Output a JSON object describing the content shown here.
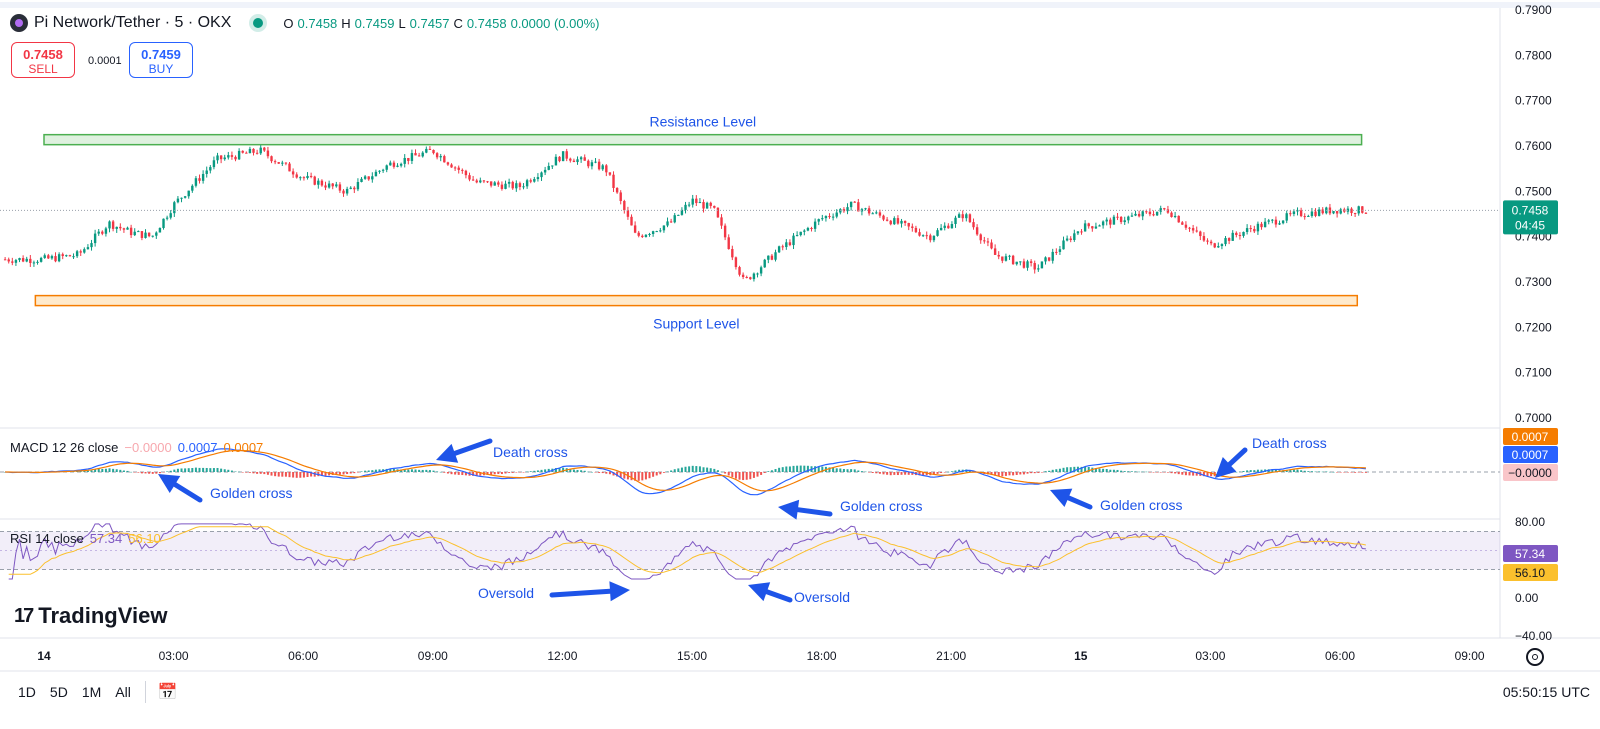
{
  "header": {
    "symbol": "Pi Network/Tether · 5 · OKX",
    "o_label": "O",
    "o": "0.7458",
    "h_label": "H",
    "h": "0.7459",
    "l_label": "L",
    "l": "0.7457",
    "c_label": "C",
    "c": "0.7458",
    "change": "0.0000 (0.00%)"
  },
  "trade": {
    "sell_price": "0.7458",
    "sell_label": "SELL",
    "spread": "0.0001",
    "buy_price": "0.7459",
    "buy_label": "BUY"
  },
  "macd_legend": {
    "name": "MACD 12 26 close",
    "hist": "−0.0000",
    "macd": "0.0007",
    "signal": "0.0007"
  },
  "rsi_legend": {
    "name": "RSI 14 close",
    "rsi": "57.34",
    "ma": "56.10"
  },
  "brand": "TradingView",
  "range_buttons": [
    "1D",
    "5D",
    "1M",
    "All"
  ],
  "clock": "05:50:15 UTC",
  "colors": {
    "up": "#089981",
    "down": "#f23645",
    "macd": "#2962ff",
    "signal": "#f57c00",
    "rsi": "#7e57c2",
    "rsi_ma": "#fbc02d",
    "annotation": "#1e54e8"
  },
  "chart_data": [
    {
      "type": "candlestick",
      "ylim": [
        0.7,
        0.79
      ],
      "yticks": [
        "0.7000",
        "0.7100",
        "0.7200",
        "0.7300",
        "0.7400",
        "0.7500",
        "0.7600",
        "0.7700",
        "0.7800",
        "0.7900"
      ],
      "xticks": [
        "14",
        "03:00",
        "06:00",
        "09:00",
        "12:00",
        "15:00",
        "18:00",
        "21:00",
        "15",
        "03:00",
        "06:00",
        "09:00"
      ],
      "x_hours": [
        0,
        3,
        6,
        9,
        12,
        15,
        18,
        21,
        24,
        27,
        30,
        33
      ],
      "price_path": [
        [
          0.0,
          0.735
        ],
        [
          0.8,
          0.736
        ],
        [
          1.5,
          0.743
        ],
        [
          2.0,
          0.741
        ],
        [
          2.5,
          0.74
        ],
        [
          3.0,
          0.747
        ],
        [
          4.0,
          0.757
        ],
        [
          5.0,
          0.759
        ],
        [
          6.0,
          0.753
        ],
        [
          7.0,
          0.75
        ],
        [
          8.0,
          0.756
        ],
        [
          9.0,
          0.759
        ],
        [
          10.0,
          0.752
        ],
        [
          11.0,
          0.751
        ],
        [
          12.0,
          0.758
        ],
        [
          13.0,
          0.755
        ],
        [
          13.7,
          0.74
        ],
        [
          14.5,
          0.743
        ],
        [
          15.0,
          0.748
        ],
        [
          15.5,
          0.746
        ],
        [
          16.2,
          0.73
        ],
        [
          17.0,
          0.737
        ],
        [
          18.0,
          0.744
        ],
        [
          18.7,
          0.747
        ],
        [
          19.5,
          0.744
        ],
        [
          20.5,
          0.74
        ],
        [
          21.3,
          0.745
        ],
        [
          22.0,
          0.736
        ],
        [
          23.0,
          0.733
        ],
        [
          24.0,
          0.742
        ],
        [
          25.0,
          0.744
        ],
        [
          26.0,
          0.746
        ],
        [
          27.0,
          0.738
        ],
        [
          28.0,
          0.742
        ],
        [
          29.0,
          0.745
        ],
        [
          30.0,
          0.746
        ],
        [
          30.6,
          0.7458
        ]
      ],
      "last_price": "0.7458",
      "countdown": "04:45",
      "zones": [
        {
          "label": "Resistance Level",
          "y_low": 0.761,
          "y_high": 0.7625,
          "x_start": 0.0,
          "x_end": 30.5,
          "color": "green"
        },
        {
          "label": "Support Level",
          "y_low": 0.7255,
          "y_high": 0.727,
          "x_start": -0.2,
          "x_end": 30.4,
          "color": "orange"
        }
      ]
    },
    {
      "type": "macd",
      "price_labels": [
        "0.0007",
        "0.0007",
        "−0.0000"
      ],
      "annotations": [
        {
          "text": "Death cross",
          "x_hour": 9.0
        },
        {
          "text": "Golden cross",
          "x_hour": 2.7
        },
        {
          "text": "Golden cross",
          "x_hour": 16.3
        },
        {
          "text": "Golden cross",
          "x_hour": 23.3
        },
        {
          "text": "Death cross",
          "x_hour": 28.0
        }
      ]
    },
    {
      "type": "rsi",
      "ylim": [
        -40,
        80
      ],
      "yticks": [
        "80.00",
        "0.00",
        "−40.00"
      ],
      "bands": [
        30,
        70
      ],
      "value_labels": [
        "57.34",
        "56.10"
      ],
      "annotations": [
        {
          "text": "Oversold",
          "x_hour": 13.8
        },
        {
          "text": "Oversold",
          "x_hour": 16.5
        }
      ]
    }
  ]
}
